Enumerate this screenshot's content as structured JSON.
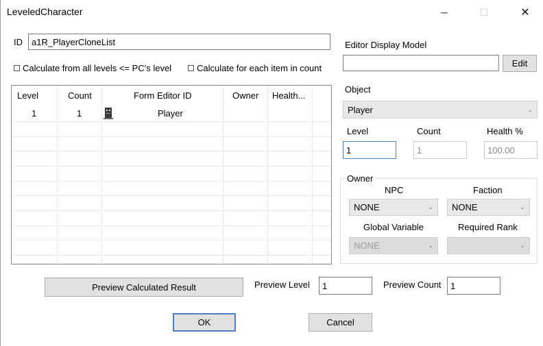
{
  "window": {
    "title": "LeveledCharacter"
  },
  "title_buttons": {
    "minimize": "─",
    "maximize": "☐",
    "close": "✕"
  },
  "id_field": {
    "label": "ID",
    "value": "a1R_PlayerCloneList"
  },
  "options": {
    "calc_all_levels": "Calculate from all levels <= PC's level",
    "calc_each_item": "Calculate for each item in count"
  },
  "list": {
    "headers": [
      "Level",
      "Count",
      "Form Editor ID",
      "Owner",
      "Health..."
    ],
    "rows": [
      {
        "level": "1",
        "count": "1",
        "form_editor_id": "Player",
        "owner": "",
        "health": ""
      }
    ]
  },
  "editor_display_model": {
    "label": "Editor Display Model",
    "value": "",
    "edit_label": "Edit"
  },
  "object": {
    "label": "Object",
    "value": "Player"
  },
  "entry": {
    "level_label": "Level",
    "level_value": "1",
    "count_label": "Count",
    "count_value": "1",
    "health_label": "Health %",
    "health_value": "100.00"
  },
  "owner_group": {
    "label": "Owner",
    "npc_label": "NPC",
    "npc_value": "NONE",
    "faction_label": "Faction",
    "faction_value": "NONE",
    "global_var_label": "Global Variable",
    "global_var_value": "NONE",
    "required_rank_label": "Required Rank",
    "required_rank_value": ""
  },
  "preview": {
    "button_label": "Preview Calculated Result",
    "level_label": "Preview Level",
    "level_value": "1",
    "count_label": "Preview Count",
    "count_value": "1"
  },
  "dialog_buttons": {
    "ok": "OK",
    "cancel": "Cancel"
  }
}
